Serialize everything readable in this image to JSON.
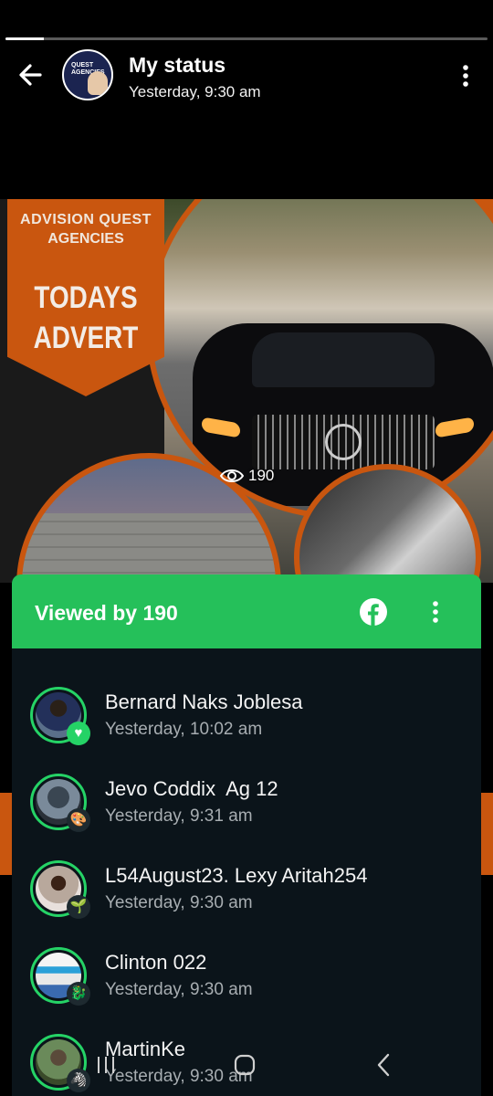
{
  "status_progress": 0.08,
  "header": {
    "title": "My status",
    "subtitle": "Yesterday, 9:30 am",
    "avatar_icon": "business-logo-avatar",
    "back_icon": "arrow-left-icon",
    "menu_icon": "more-vertical-icon"
  },
  "status_image": {
    "banner_line1": "ADVISION QUEST",
    "banner_line2": "AGENCIES",
    "banner_title_1": "TODAYS",
    "banner_title_2": "ADVERT",
    "views_count": "190",
    "eye_icon": "eye-icon"
  },
  "sheet": {
    "title": "Viewed by 190",
    "facebook_icon": "facebook-icon",
    "menu_icon": "more-vertical-icon",
    "accent_color": "#25C05A"
  },
  "viewers": [
    {
      "name": "Bernard Naks Joblesa",
      "time": "Yesterday, 10:02 am",
      "badge": "💚"
    },
    {
      "name": "Jevo Coddix  Ag 12",
      "time": "Yesterday, 9:31 am",
      "badge": "🎨"
    },
    {
      "name": "L54August23. Lexy Aritah254",
      "time": "Yesterday, 9:30 am",
      "badge": "🌱"
    },
    {
      "name": "Clinton 022",
      "time": "Yesterday, 9:30 am",
      "badge": "🐉"
    },
    {
      "name": "MartinKe",
      "time": "Yesterday, 9:30 am",
      "badge": "🦓"
    }
  ],
  "navbar": {
    "recent_icon": "recent-apps-icon",
    "home_icon": "home-icon",
    "back_icon": "nav-back-icon"
  }
}
